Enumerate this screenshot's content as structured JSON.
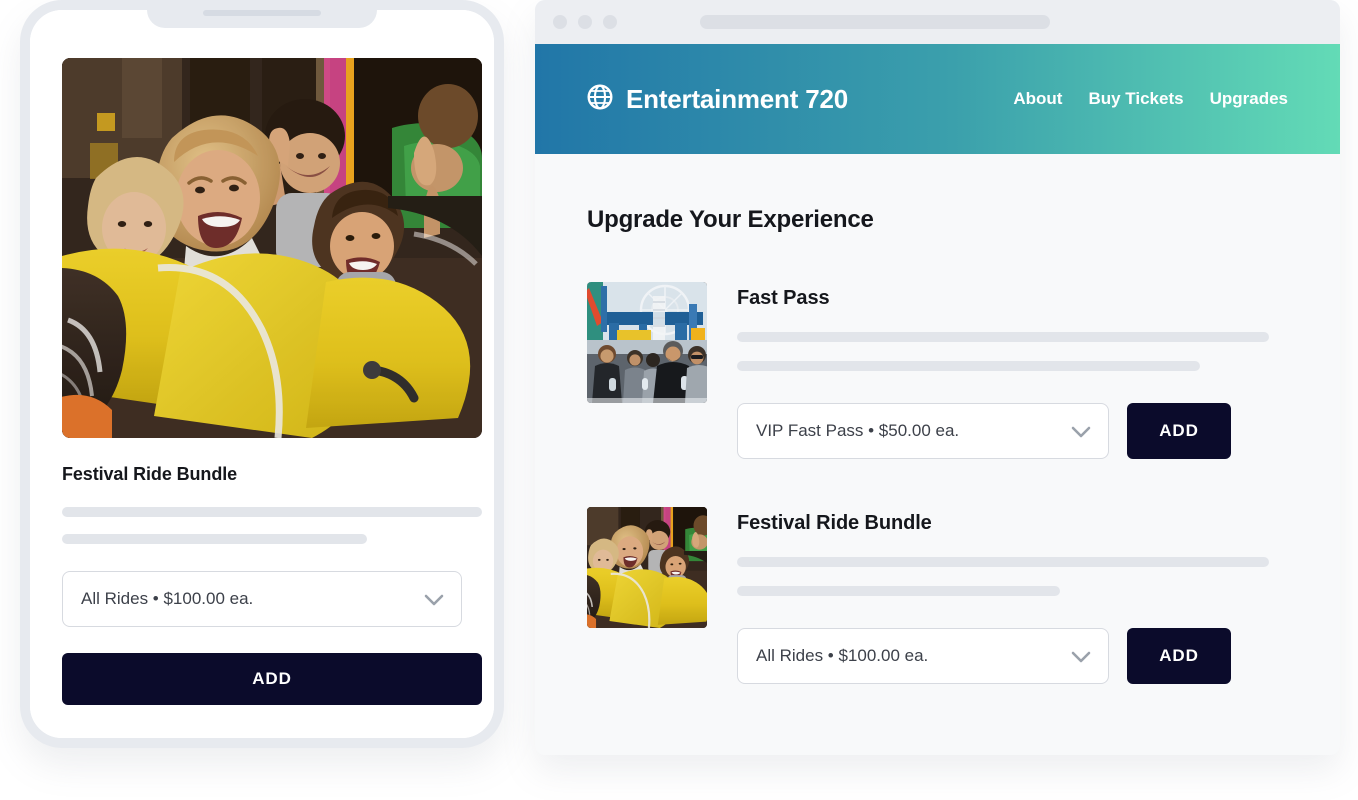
{
  "phone": {
    "hero_image": "roller-coaster-family-photo",
    "product_title": "Festival Ride Bundle",
    "select": {
      "value": "All Rides  •  $100.00 ea.",
      "icon": "chevron-down-icon"
    },
    "add_label": "ADD"
  },
  "browser": {
    "chrome": {
      "dots": [
        "window-dot-1",
        "window-dot-2",
        "window-dot-3"
      ],
      "address_bar_value": ""
    },
    "header": {
      "brand_icon": "globe-icon",
      "brand_name": "Entertainment 720",
      "nav": [
        {
          "label": "About"
        },
        {
          "label": "Buy Tickets"
        },
        {
          "label": "Upgrades"
        }
      ],
      "gradient_from": "#2176a8",
      "gradient_to": "#63dbb6"
    },
    "page_heading": "Upgrade Your Experience",
    "upgrades": [
      {
        "thumbnail": "fairground-crowd-photo",
        "title": "Fast Pass",
        "select_value": "VIP Fast Pass • $50.00 ea.",
        "select_icon": "chevron-down-icon",
        "add_label": "ADD"
      },
      {
        "thumbnail": "roller-coaster-family-photo",
        "title": "Festival Ride Bundle",
        "select_value": "All Rides  •  $100.00 ea.",
        "select_icon": "chevron-down-icon",
        "add_label": "ADD"
      }
    ]
  },
  "colors": {
    "add_button_bg": "#0b0b2b",
    "skeleton": "#e2e5ea",
    "phone_frame": "#e7eaef",
    "browser_chrome": "#eceef2"
  }
}
